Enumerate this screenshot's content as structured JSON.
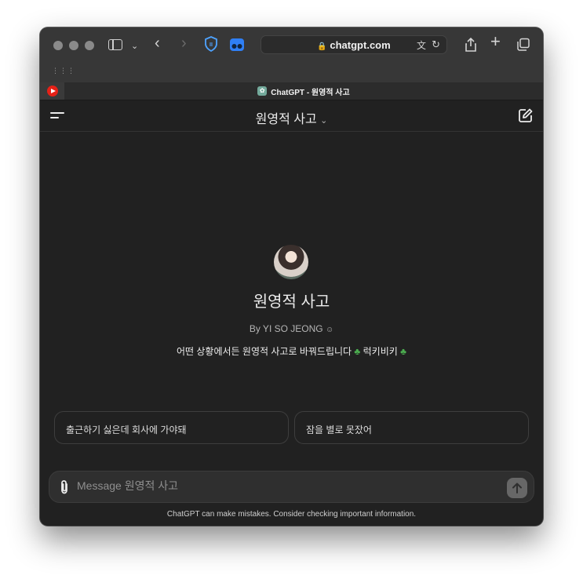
{
  "browser": {
    "url": "chatgpt.com",
    "tab_title": "ChatGPT - 원영적 사고"
  },
  "header": {
    "model_title": "원영적 사고"
  },
  "gpt": {
    "name": "원영적 사고",
    "byline": "By YI SO JEONG",
    "description": "어떤 상황에서든 원영적 사고로 바꿔드립니다",
    "description_suffix": "럭키비키"
  },
  "starters": [
    {
      "label": "출근하기 싫은데 회사에 가야돼"
    },
    {
      "label": "잠을 별로 못잤어"
    }
  ],
  "composer": {
    "placeholder": "Message 원영적 사고"
  },
  "footer": {
    "disclaimer": "ChatGPT can make mistakes. Consider checking important information."
  },
  "colors": {
    "background": "#212121",
    "toolbar": "#373737",
    "accent_bitwarden": "#2f7ff5",
    "youtube_red": "#e62117"
  }
}
